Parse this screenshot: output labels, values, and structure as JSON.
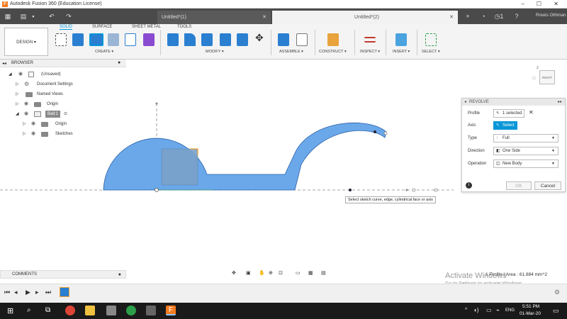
{
  "app": {
    "title": "Autodesk Fusion 360 (Education License)",
    "logo": "F"
  },
  "tabs": [
    {
      "label": "Untitled*(1)",
      "active": false
    },
    {
      "label": "Untitled*(2)",
      "active": true
    }
  ],
  "user": {
    "name": "Rowis Othman",
    "notifications": "1"
  },
  "toolbar": {
    "workspace": "DESIGN ▾",
    "ws_tabs": [
      "SOLID",
      "SURFACE",
      "SHEET METAL",
      "TOOLS"
    ],
    "groups": [
      "CREATE ▾",
      "MODIFY ▾",
      "ASSEMBLE ▾",
      "CONSTRUCT ▾",
      "INSPECT ▾",
      "INSERT ▾",
      "SELECT ▾"
    ]
  },
  "browser": {
    "title": "BROWSER",
    "items": [
      {
        "label": "(Unsaved)"
      },
      {
        "label": "Document Settings"
      },
      {
        "label": "Named Views"
      },
      {
        "label": "Origin"
      },
      {
        "label": "Ball:1"
      },
      {
        "label": "Origin"
      },
      {
        "label": "Sketches"
      }
    ]
  },
  "viewcube": {
    "label": "RIGHT"
  },
  "revolve": {
    "title": "REVOLVE",
    "profile_label": "Profile",
    "profile_value": "1 selected",
    "axis_label": "Axis",
    "axis_value": "Select",
    "type_label": "Type",
    "type_value": "Full",
    "direction_label": "Direction",
    "direction_value": "One Side",
    "operation_label": "Operation",
    "operation_value": "New Body",
    "ok": "OK",
    "cancel": "Cancel"
  },
  "tooltip": "Select sketch curve, edge, cylindrical face or axis",
  "comments": {
    "title": "COMMENTS"
  },
  "status": {
    "profile_area": "1 Profile | Area : 61.884 mm^2"
  },
  "watermark": {
    "line1": "Activate Windows",
    "line2": "Go to Settings to activate Windows."
  },
  "taskbar": {
    "time": "5:51 PM",
    "date": "01-Mar-20",
    "lang": "ENG"
  },
  "colors": {
    "profile_fill": "#6aa8ea",
    "accent": "#0696d7",
    "tab_bar": "#4a4a4a"
  }
}
